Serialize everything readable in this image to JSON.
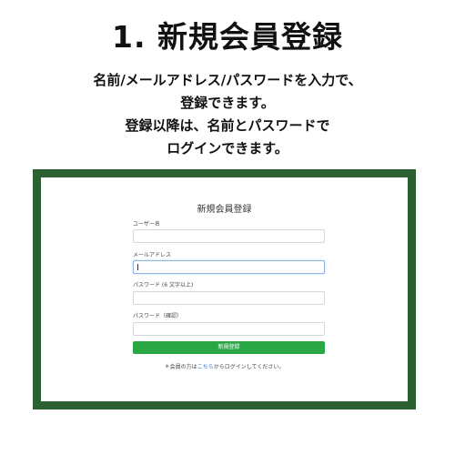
{
  "heading": "1. 新規会員登録",
  "description": [
    "名前/メールアドレス/パスワードを入力で、",
    "登録できます。",
    "登録以降は、名前とパスワードで",
    "ログインできます。"
  ],
  "form": {
    "title": "新規会員登録",
    "fields": [
      {
        "label": "ユーザー名",
        "value": ""
      },
      {
        "label": "メールアドレス",
        "value": ""
      },
      {
        "label": "パスワード (6 文字以上)",
        "value": ""
      },
      {
        "label": "パスワード（確認）",
        "value": ""
      }
    ],
    "submit_label": "新規登録",
    "login_note": {
      "prefix": "＊会員の方は",
      "link": "こちら",
      "suffix": "からログインしてください。"
    }
  }
}
